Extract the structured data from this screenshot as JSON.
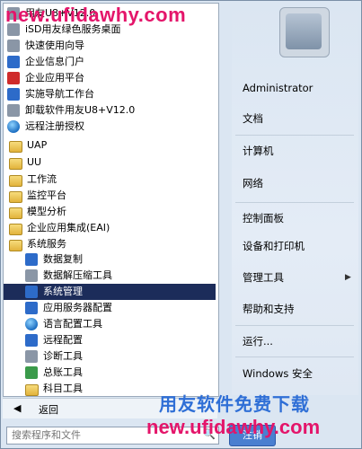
{
  "start_menu": {
    "left_items": [
      {
        "label": "用友U8+V12.0",
        "icon": "yonyou-folder-icon",
        "name": "item-yonyou-u8",
        "interactable": true
      },
      {
        "label": "iSD用友绿色服务桌面",
        "icon": "isd-icon",
        "name": "item-isd-desktop",
        "interactable": true
      },
      {
        "label": "快速使用向导",
        "icon": "wizard-icon",
        "name": "item-quick-wizard",
        "interactable": true
      },
      {
        "label": "企业信息门户",
        "icon": "u8-portal-icon",
        "name": "item-enterprise-portal",
        "interactable": true
      },
      {
        "label": "企业应用平台",
        "icon": "u8-platform-icon",
        "name": "item-enterprise-platform",
        "interactable": true
      },
      {
        "label": "实施导航工作台",
        "icon": "navigator-icon",
        "name": "item-implementation-navigator",
        "interactable": true
      },
      {
        "label": "卸载软件用友U8+V12.0",
        "icon": "uninstall-icon",
        "name": "item-uninstall",
        "interactable": true
      },
      {
        "label": "远程注册授权",
        "icon": "globe-icon",
        "name": "item-remote-license",
        "interactable": true
      },
      {
        "label": "UAP",
        "icon": "folder-icon",
        "name": "item-uap",
        "interactable": true
      },
      {
        "label": "UU",
        "icon": "folder-icon",
        "name": "item-uu",
        "interactable": true
      },
      {
        "label": "工作流",
        "icon": "folder-icon",
        "name": "item-workflow",
        "interactable": true
      },
      {
        "label": "监控平台",
        "icon": "folder-icon",
        "name": "item-monitor-platform",
        "interactable": true
      },
      {
        "label": "模型分析",
        "icon": "folder-icon",
        "name": "item-model-analysis",
        "interactable": true
      },
      {
        "label": "企业应用集成(EAI)",
        "icon": "folder-icon",
        "name": "item-eai",
        "interactable": true
      },
      {
        "label": "系统服务",
        "icon": "folder-icon",
        "name": "item-system-services",
        "interactable": true
      },
      {
        "label": "数据复制",
        "icon": "data-copy-icon",
        "name": "item-data-copy",
        "interactable": true
      },
      {
        "label": "数据解压缩工具",
        "icon": "decompress-icon",
        "name": "item-decompress-tool",
        "interactable": true
      },
      {
        "label": "系统管理",
        "icon": "monitor-icon",
        "name": "item-system-admin",
        "interactable": true,
        "selected": true
      },
      {
        "label": "应用服务器配置",
        "icon": "server-config-icon",
        "name": "item-app-server-config",
        "interactable": true
      },
      {
        "label": "语言配置工具",
        "icon": "language-icon",
        "name": "item-language-config",
        "interactable": true
      },
      {
        "label": "远程配置",
        "icon": "wrench-icon",
        "name": "item-remote-config",
        "interactable": true
      },
      {
        "label": "诊断工具",
        "icon": "diagnostic-icon",
        "name": "item-diagnostic-tool",
        "interactable": true
      },
      {
        "label": "总账工具",
        "icon": "ledger-icon",
        "name": "item-ledger-tool",
        "interactable": true
      },
      {
        "label": "科目工具",
        "icon": "folder-icon",
        "name": "item-subject-tool",
        "interactable": true
      }
    ],
    "back_label": "返回",
    "search_placeholder": "搜索程序和文件",
    "right_items": [
      {
        "label": "Administrator",
        "name": "right-item-administrator"
      },
      {
        "label": "文档",
        "name": "right-item-documents"
      },
      {
        "label": "计算机",
        "name": "right-item-computer"
      },
      {
        "label": "网络",
        "name": "right-item-network"
      },
      {
        "label": "控制面板",
        "name": "right-item-control-panel"
      },
      {
        "label": "设备和打印机",
        "name": "right-item-devices-printers"
      },
      {
        "label": "管理工具",
        "name": "right-item-admin-tools"
      },
      {
        "label": "帮助和支持",
        "name": "right-item-help-support"
      },
      {
        "label": "运行...",
        "name": "right-item-run"
      },
      {
        "label": "Windows 安全",
        "name": "right-item-windows-security"
      }
    ],
    "shutdown_label": "注销"
  },
  "watermarks": {
    "top_url": "new.ufidawhy.com",
    "bottom_text": "用友软件免费下载",
    "bottom_url": "new.ufidawhy.com"
  },
  "colors": {
    "selection": "#1c2c5a",
    "watermark_pink": "#e4156a",
    "watermark_blue": "#2f6fd6"
  }
}
